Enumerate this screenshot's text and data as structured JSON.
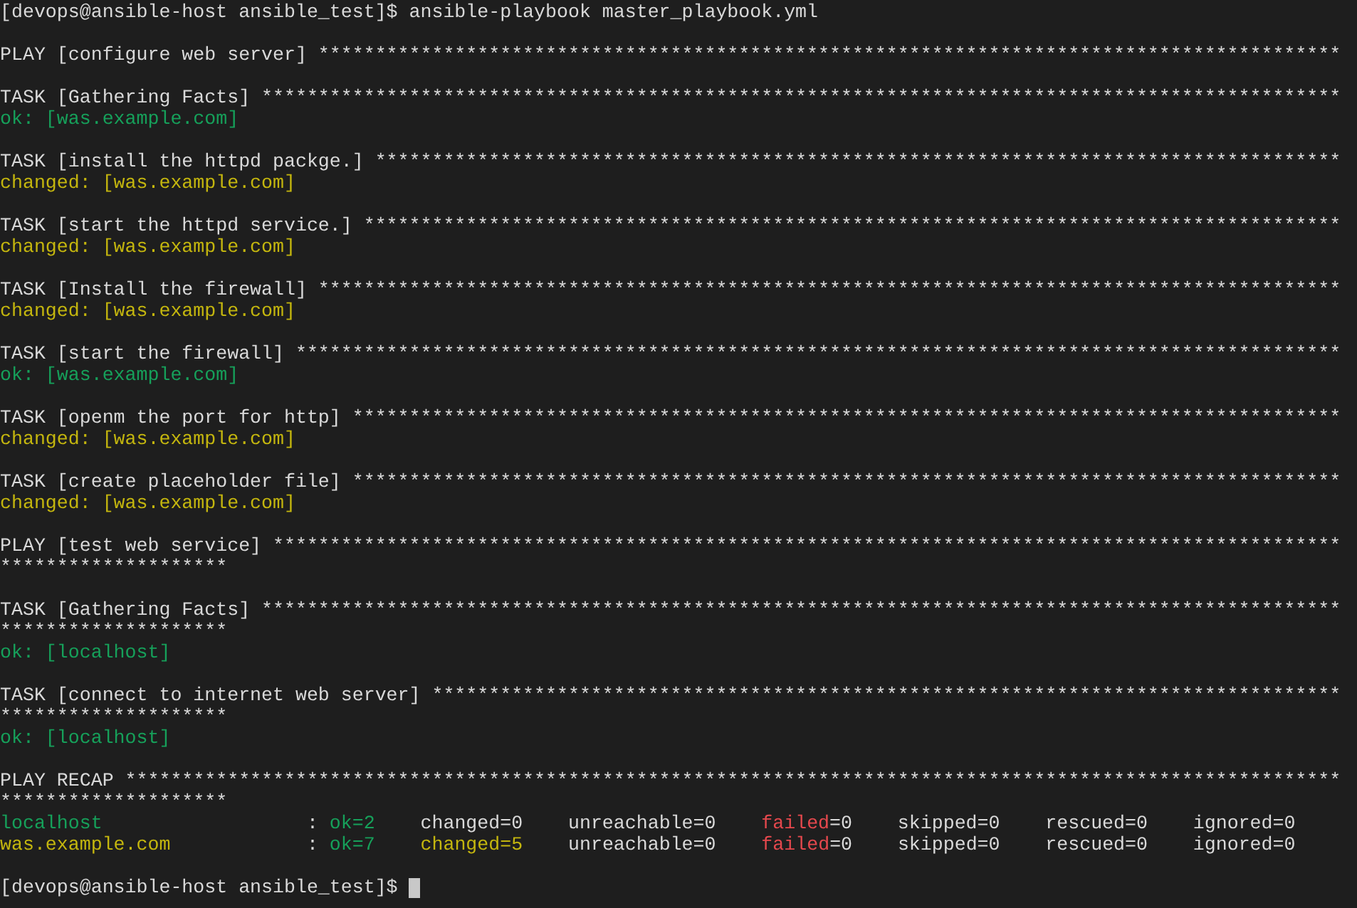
{
  "blocks": [
    {
      "lines": [
        {
          "segments": [
            {
              "text": "[devops@ansible-host ansible_test]$ ansible-playbook master_playbook.yml",
              "kind": "plain"
            }
          ]
        }
      ]
    },
    {
      "lines": [
        {
          "segments": [
            {
              "text": "PLAY [configure web server] ******************************************************************************************",
              "kind": "plain"
            }
          ]
        }
      ]
    },
    {
      "lines": [
        {
          "segments": [
            {
              "text": "TASK [Gathering Facts] ***********************************************************************************************",
              "kind": "plain"
            }
          ]
        },
        {
          "segments": [
            {
              "text": "ok: [was.example.com]",
              "kind": "ok"
            }
          ]
        }
      ]
    },
    {
      "lines": [
        {
          "segments": [
            {
              "text": "TASK [install the httpd packge.] *************************************************************************************",
              "kind": "plain"
            }
          ]
        },
        {
          "segments": [
            {
              "text": "changed: [was.example.com]",
              "kind": "changed"
            }
          ]
        }
      ]
    },
    {
      "lines": [
        {
          "segments": [
            {
              "text": "TASK [start the httpd service.] **************************************************************************************",
              "kind": "plain"
            }
          ]
        },
        {
          "segments": [
            {
              "text": "changed: [was.example.com]",
              "kind": "changed"
            }
          ]
        }
      ]
    },
    {
      "lines": [
        {
          "segments": [
            {
              "text": "TASK [Install the firewall] ******************************************************************************************",
              "kind": "plain"
            }
          ]
        },
        {
          "segments": [
            {
              "text": "changed: [was.example.com]",
              "kind": "changed"
            }
          ]
        }
      ]
    },
    {
      "lines": [
        {
          "segments": [
            {
              "text": "TASK [start the firewall] ********************************************************************************************",
              "kind": "plain"
            }
          ]
        },
        {
          "segments": [
            {
              "text": "ok: [was.example.com]",
              "kind": "ok"
            }
          ]
        }
      ]
    },
    {
      "lines": [
        {
          "segments": [
            {
              "text": "TASK [openm the port for http] ***************************************************************************************",
              "kind": "plain"
            }
          ]
        },
        {
          "segments": [
            {
              "text": "changed: [was.example.com]",
              "kind": "changed"
            }
          ]
        }
      ]
    },
    {
      "lines": [
        {
          "segments": [
            {
              "text": "TASK [create placeholder file] ***************************************************************************************",
              "kind": "plain"
            }
          ]
        },
        {
          "segments": [
            {
              "text": "changed: [was.example.com]",
              "kind": "changed"
            }
          ]
        }
      ]
    },
    {
      "lines": [
        {
          "segments": [
            {
              "text": "PLAY [test web service] **********************************************************************************************",
              "kind": "plain"
            }
          ]
        },
        {
          "segments": [
            {
              "text": "********************",
              "kind": "plain"
            }
          ]
        }
      ]
    },
    {
      "lines": [
        {
          "segments": [
            {
              "text": "TASK [Gathering Facts] ***********************************************************************************************",
              "kind": "plain"
            }
          ]
        },
        {
          "segments": [
            {
              "text": "********************",
              "kind": "plain"
            }
          ]
        },
        {
          "segments": [
            {
              "text": "ok: [localhost]",
              "kind": "ok"
            }
          ]
        }
      ]
    },
    {
      "lines": [
        {
          "segments": [
            {
              "text": "TASK [connect to internet web server] ********************************************************************************",
              "kind": "plain"
            }
          ]
        },
        {
          "segments": [
            {
              "text": "********************",
              "kind": "plain"
            }
          ]
        },
        {
          "segments": [
            {
              "text": "ok: [localhost]",
              "kind": "ok"
            }
          ]
        }
      ]
    },
    {
      "lines": [
        {
          "segments": [
            {
              "text": "PLAY RECAP ***********************************************************************************************************",
              "kind": "plain"
            }
          ]
        },
        {
          "segments": [
            {
              "text": "********************",
              "kind": "plain"
            }
          ]
        },
        {
          "segments": [
            {
              "text": "localhost",
              "kind": "ok"
            },
            {
              "text": "                  : ",
              "kind": "plain"
            },
            {
              "text": "ok=2",
              "kind": "ok"
            },
            {
              "text": "    changed=0    unreachable=0    ",
              "kind": "plain"
            },
            {
              "text": "failed",
              "kind": "failed"
            },
            {
              "text": "=0    skipped=0    rescued=0    ignored=0",
              "kind": "plain"
            }
          ]
        },
        {
          "segments": [
            {
              "text": "was.example.com",
              "kind": "changed"
            },
            {
              "text": "            : ",
              "kind": "plain"
            },
            {
              "text": "ok=7    ",
              "kind": "ok"
            },
            {
              "text": "changed=5",
              "kind": "changed"
            },
            {
              "text": "    unreachable=0    ",
              "kind": "plain"
            },
            {
              "text": "failed",
              "kind": "failed"
            },
            {
              "text": "=0    skipped=0    rescued=0    ignored=0",
              "kind": "plain"
            }
          ]
        }
      ]
    },
    {
      "lines": [
        {
          "segments": [
            {
              "text": "[devops@ansible-host ansible_test]$ ",
              "kind": "plain"
            }
          ],
          "cursor": true
        }
      ]
    }
  ]
}
